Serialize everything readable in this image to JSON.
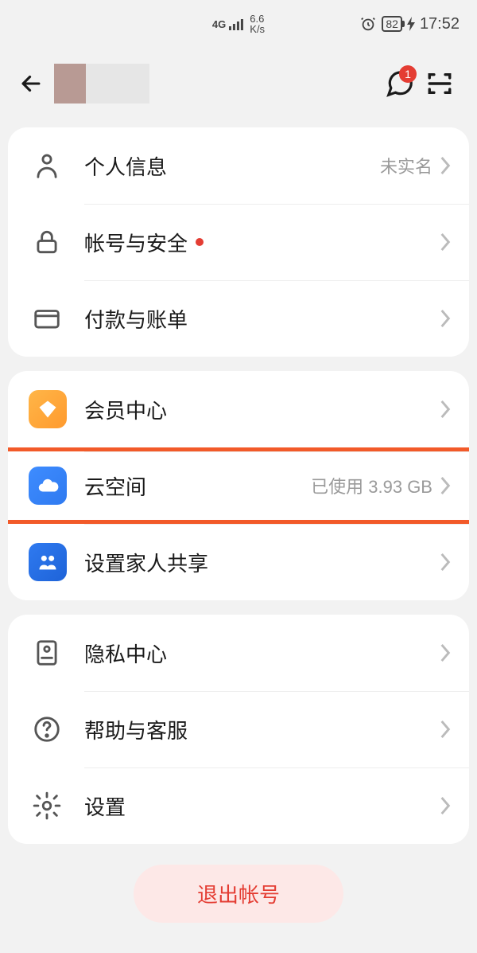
{
  "status": {
    "network_label": "4G",
    "speed_value": "6.6",
    "speed_unit": "K/s",
    "battery": "82",
    "time": "17:52"
  },
  "header": {
    "chat_badge": "1"
  },
  "section1": {
    "personal_info_label": "个人信息",
    "personal_info_status": "未实名",
    "account_security_label": "帐号与安全",
    "payment_label": "付款与账单"
  },
  "section2": {
    "member_center_label": "会员中心",
    "cloud_label": "云空间",
    "cloud_usage": "已使用 3.93 GB",
    "family_share_label": "设置家人共享"
  },
  "section3": {
    "privacy_label": "隐私中心",
    "help_label": "帮助与客服",
    "settings_label": "设置"
  },
  "logout_label": "退出帐号"
}
